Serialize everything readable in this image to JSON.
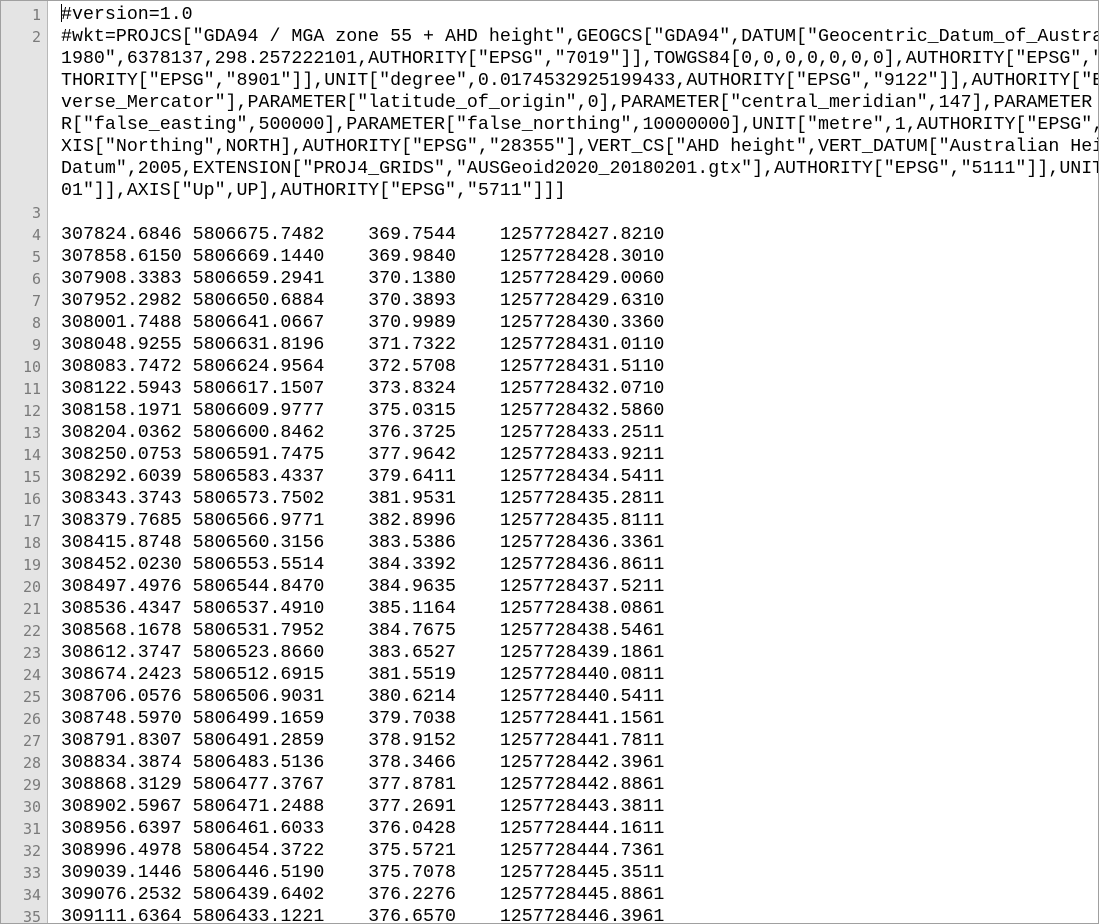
{
  "line_numbers": [
    "1",
    "2",
    "",
    "",
    "",
    "",
    "",
    "",
    "",
    "3",
    "4",
    "5",
    "6",
    "7",
    "8",
    "9",
    "10",
    "11",
    "12",
    "13",
    "14",
    "15",
    "16",
    "17",
    "18",
    "19",
    "20",
    "21",
    "22",
    "23",
    "24",
    "25",
    "26",
    "27",
    "28",
    "29",
    "30",
    "31",
    "32",
    "33",
    "34",
    "35"
  ],
  "lines": [
    "#version=1.0",
    "#wkt=PROJCS[\"GDA94 / MGA zone 55 + AHD height\",GEOGCS[\"GDA94\",DATUM[\"Geocentric_Datum_of_Austra",
    "1980\",6378137,298.257222101,AUTHORITY[\"EPSG\",\"7019\"]],TOWGS84[0,0,0,0,0,0,0],AUTHORITY[\"EPSG\",\"",
    "THORITY[\"EPSG\",\"8901\"]],UNIT[\"degree\",0.0174532925199433,AUTHORITY[\"EPSG\",\"9122\"]],AUTHORITY[\"E",
    "verse_Mercator\"],PARAMETER[\"latitude_of_origin\",0],PARAMETER[\"central_meridian\",147],PARAMETER",
    "R[\"false_easting\",500000],PARAMETER[\"false_northing\",10000000],UNIT[\"metre\",1,AUTHORITY[\"EPSG\",",
    "XIS[\"Northing\",NORTH],AUTHORITY[\"EPSG\",\"28355\"],VERT_CS[\"AHD height\",VERT_DATUM[\"Australian Hei",
    "Datum\",2005,EXTENSION[\"PROJ4_GRIDS\",\"AUSGeoid2020_20180201.gtx\"],AUTHORITY[\"EPSG\",\"5111\"]],UNIT",
    "01\"]],AXIS[\"Up\",UP],AUTHORITY[\"EPSG\",\"5711\"]]]",
    "",
    "307824.6846 5806675.7482    369.7544    1257728427.8210",
    "307858.6150 5806669.1440    369.9840    1257728428.3010",
    "307908.3383 5806659.2941    370.1380    1257728429.0060",
    "307952.2982 5806650.6884    370.3893    1257728429.6310",
    "308001.7488 5806641.0667    370.9989    1257728430.3360",
    "308048.9255 5806631.8196    371.7322    1257728431.0110",
    "308083.7472 5806624.9564    372.5708    1257728431.5110",
    "308122.5943 5806617.1507    373.8324    1257728432.0710",
    "308158.1971 5806609.9777    375.0315    1257728432.5860",
    "308204.0362 5806600.8462    376.3725    1257728433.2511",
    "308250.0753 5806591.7475    377.9642    1257728433.9211",
    "308292.6039 5806583.4337    379.6411    1257728434.5411",
    "308343.3743 5806573.7502    381.9531    1257728435.2811",
    "308379.7685 5806566.9771    382.8996    1257728435.8111",
    "308415.8748 5806560.3156    383.5386    1257728436.3361",
    "308452.0230 5806553.5514    384.3392    1257728436.8611",
    "308497.4976 5806544.8470    384.9635    1257728437.5211",
    "308536.4347 5806537.4910    385.1164    1257728438.0861",
    "308568.1678 5806531.7952    384.7675    1257728438.5461",
    "308612.3747 5806523.8660    383.6527    1257728439.1861",
    "308674.2423 5806512.6915    381.5519    1257728440.0811",
    "308706.0576 5806506.9031    380.6214    1257728440.5411",
    "308748.5970 5806499.1659    379.7038    1257728441.1561",
    "308791.8307 5806491.2859    378.9152    1257728441.7811",
    "308834.3874 5806483.5136    378.3466    1257728442.3961",
    "308868.3129 5806477.3767    377.8781    1257728442.8861",
    "308902.5967 5806471.2488    377.2691    1257728443.3811",
    "308956.6397 5806461.6033    376.0428    1257728444.1611",
    "308996.4978 5806454.3722    375.5721    1257728444.7361",
    "309039.1446 5806446.5190    375.7078    1257728445.3511",
    "309076.2532 5806439.6402    376.2276    1257728445.8861",
    "309111.6364 5806433.1221    376.6570    1257728446.3961"
  ]
}
